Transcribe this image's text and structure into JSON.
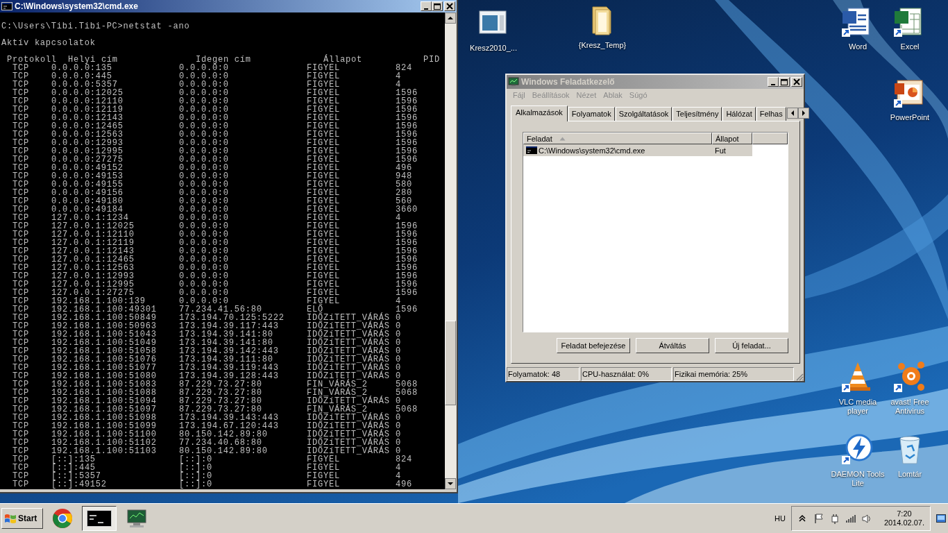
{
  "desktop_icons": [
    {
      "label": "Kresz2010_...",
      "kind": "window-file"
    },
    {
      "label": "{Kresz_Temp}",
      "kind": "folder"
    },
    {
      "label": "Word",
      "kind": "word"
    },
    {
      "label": "Excel",
      "kind": "excel"
    },
    {
      "label": "PowerPoint",
      "kind": "powerpoint"
    },
    {
      "label": "VLC media player",
      "kind": "vlc"
    },
    {
      "label": "avast! Free Antivirus",
      "kind": "avast"
    },
    {
      "label": "DAEMON Tools Lite",
      "kind": "daemon"
    },
    {
      "label": "Lomtár",
      "kind": "recycle-bin"
    }
  ],
  "cmd_window": {
    "title": "C:\\Windows\\system32\\cmd.exe",
    "prompt": "C:\\Users\\Tibi.Tibi-PC>netstat -ano",
    "heading": "Aktív kapcsolatok",
    "columns": [
      "Protokoll",
      "Helyi cím",
      "Idegen cím",
      "Állapot",
      "PID"
    ],
    "rows": [
      [
        "TCP",
        "0.0.0.0:135",
        "0.0.0.0:0",
        "FIGYEL",
        "824"
      ],
      [
        "TCP",
        "0.0.0.0:445",
        "0.0.0.0:0",
        "FIGYEL",
        "4"
      ],
      [
        "TCP",
        "0.0.0.0:5357",
        "0.0.0.0:0",
        "FIGYEL",
        "4"
      ],
      [
        "TCP",
        "0.0.0.0:12025",
        "0.0.0.0:0",
        "FIGYEL",
        "1596"
      ],
      [
        "TCP",
        "0.0.0.0:12110",
        "0.0.0.0:0",
        "FIGYEL",
        "1596"
      ],
      [
        "TCP",
        "0.0.0.0:12119",
        "0.0.0.0:0",
        "FIGYEL",
        "1596"
      ],
      [
        "TCP",
        "0.0.0.0:12143",
        "0.0.0.0:0",
        "FIGYEL",
        "1596"
      ],
      [
        "TCP",
        "0.0.0.0:12465",
        "0.0.0.0:0",
        "FIGYEL",
        "1596"
      ],
      [
        "TCP",
        "0.0.0.0:12563",
        "0.0.0.0:0",
        "FIGYEL",
        "1596"
      ],
      [
        "TCP",
        "0.0.0.0:12993",
        "0.0.0.0:0",
        "FIGYEL",
        "1596"
      ],
      [
        "TCP",
        "0.0.0.0:12995",
        "0.0.0.0:0",
        "FIGYEL",
        "1596"
      ],
      [
        "TCP",
        "0.0.0.0:27275",
        "0.0.0.0:0",
        "FIGYEL",
        "1596"
      ],
      [
        "TCP",
        "0.0.0.0:49152",
        "0.0.0.0:0",
        "FIGYEL",
        "496"
      ],
      [
        "TCP",
        "0.0.0.0:49153",
        "0.0.0.0:0",
        "FIGYEL",
        "948"
      ],
      [
        "TCP",
        "0.0.0.0:49155",
        "0.0.0.0:0",
        "FIGYEL",
        "580"
      ],
      [
        "TCP",
        "0.0.0.0:49156",
        "0.0.0.0:0",
        "FIGYEL",
        "280"
      ],
      [
        "TCP",
        "0.0.0.0:49180",
        "0.0.0.0:0",
        "FIGYEL",
        "560"
      ],
      [
        "TCP",
        "0.0.0.0:49184",
        "0.0.0.0:0",
        "FIGYEL",
        "3660"
      ],
      [
        "TCP",
        "127.0.0.1:1234",
        "0.0.0.0:0",
        "FIGYEL",
        "4"
      ],
      [
        "TCP",
        "127.0.0.1:12025",
        "0.0.0.0:0",
        "FIGYEL",
        "1596"
      ],
      [
        "TCP",
        "127.0.0.1:12110",
        "0.0.0.0:0",
        "FIGYEL",
        "1596"
      ],
      [
        "TCP",
        "127.0.0.1:12119",
        "0.0.0.0:0",
        "FIGYEL",
        "1596"
      ],
      [
        "TCP",
        "127.0.0.1:12143",
        "0.0.0.0:0",
        "FIGYEL",
        "1596"
      ],
      [
        "TCP",
        "127.0.0.1:12465",
        "0.0.0.0:0",
        "FIGYEL",
        "1596"
      ],
      [
        "TCP",
        "127.0.0.1:12563",
        "0.0.0.0:0",
        "FIGYEL",
        "1596"
      ],
      [
        "TCP",
        "127.0.0.1:12993",
        "0.0.0.0:0",
        "FIGYEL",
        "1596"
      ],
      [
        "TCP",
        "127.0.0.1:12995",
        "0.0.0.0:0",
        "FIGYEL",
        "1596"
      ],
      [
        "TCP",
        "127.0.0.1:27275",
        "0.0.0.0:0",
        "FIGYEL",
        "1596"
      ],
      [
        "TCP",
        "192.168.1.100:139",
        "0.0.0.0:0",
        "FIGYEL",
        "4"
      ],
      [
        "TCP",
        "192.168.1.100:49301",
        "77.234.41.56:80",
        "ELŐ",
        "1596"
      ],
      [
        "TCP",
        "192.168.1.100:50849",
        "173.194.70.125:5222",
        "IDŐZíTETT_VÁRÁS",
        "0"
      ],
      [
        "TCP",
        "192.168.1.100:50963",
        "173.194.39.117:443",
        "IDŐZíTETT_VÁRÁS",
        "0"
      ],
      [
        "TCP",
        "192.168.1.100:51043",
        "173.194.39.141:80",
        "IDŐZíTETT_VÁRÁS",
        "0"
      ],
      [
        "TCP",
        "192.168.1.100:51049",
        "173.194.39.141:80",
        "IDŐZíTETT_VÁRÁS",
        "0"
      ],
      [
        "TCP",
        "192.168.1.100:51058",
        "173.194.39.142:443",
        "IDŐZíTETT_VÁRÁS",
        "0"
      ],
      [
        "TCP",
        "192.168.1.100:51076",
        "173.194.39.111:80",
        "IDŐZíTETT_VÁRÁS",
        "0"
      ],
      [
        "TCP",
        "192.168.1.100:51077",
        "173.194.39.119:443",
        "IDŐZíTETT_VÁRÁS",
        "0"
      ],
      [
        "TCP",
        "192.168.1.100:51080",
        "173.194.39.128:443",
        "IDŐZíTETT_VÁRÁS",
        "0"
      ],
      [
        "TCP",
        "192.168.1.100:51083",
        "87.229.73.27:80",
        "FIN_VÁRÁS_2",
        "5068"
      ],
      [
        "TCP",
        "192.168.1.100:51088",
        "87.229.73.27:80",
        "FIN_VÁRÁS_2",
        "5068"
      ],
      [
        "TCP",
        "192.168.1.100:51094",
        "87.229.73.27:80",
        "IDŐZíTETT_VÁRÁS",
        "0"
      ],
      [
        "TCP",
        "192.168.1.100:51097",
        "87.229.73.27:80",
        "FIN_VÁRÁS_2",
        "5068"
      ],
      [
        "TCP",
        "192.168.1.100:51098",
        "173.194.39.143:443",
        "IDŐZíTETT_VÁRÁS",
        "0"
      ],
      [
        "TCP",
        "192.168.1.100:51099",
        "173.194.67.120:443",
        "IDŐZíTETT_VÁRÁS",
        "0"
      ],
      [
        "TCP",
        "192.168.1.100:51100",
        "80.150.142.89:80",
        "IDŐZíTETT_VÁRÁS",
        "0"
      ],
      [
        "TCP",
        "192.168.1.100:51102",
        "77.234.40.68:80",
        "IDŐZíTETT_VÁRÁS",
        "0"
      ],
      [
        "TCP",
        "192.168.1.100:51103",
        "80.150.142.89:80",
        "IDŐZíTETT_VÁRÁS",
        "0"
      ],
      [
        "TCP",
        "[::]:135",
        "[::]:0",
        "FIGYEL",
        "824"
      ],
      [
        "TCP",
        "[::]:445",
        "[::]:0",
        "FIGYEL",
        "4"
      ],
      [
        "TCP",
        "[::]:5357",
        "[::]:0",
        "FIGYEL",
        "4"
      ],
      [
        "TCP",
        "[::]:49152",
        "[::]:0",
        "FIGYEL",
        "496"
      ]
    ]
  },
  "task_manager": {
    "title": "Windows Feladatkezelő",
    "menu": [
      "Fájl",
      "Beállítások",
      "Nézet",
      "Ablak",
      "Súgó"
    ],
    "tabs": [
      {
        "label": "Alkalmazások",
        "selected": true
      },
      {
        "label": "Folyamatok",
        "selected": false
      },
      {
        "label": "Szolgáltatások",
        "selected": false
      },
      {
        "label": "Teljesítmény",
        "selected": false
      },
      {
        "label": "Hálózat",
        "selected": false
      },
      {
        "label": "Felhas",
        "selected": false
      }
    ],
    "columns": [
      {
        "label": "Feladat",
        "sorted": true
      },
      {
        "label": "Állapot",
        "sorted": false
      }
    ],
    "rows": [
      {
        "task": "C:\\Windows\\system32\\cmd.exe",
        "status": "Fut",
        "selected": true
      }
    ],
    "buttons": [
      "Feladat befejezése",
      "Átváltás",
      "Új feladat..."
    ],
    "status_bar": [
      "Folyamatok: 48",
      "CPU-használat: 0%",
      "Fizikai memória: 25%"
    ]
  },
  "taskbar": {
    "start": "Start",
    "apps": [
      {
        "kind": "browser",
        "selected": false
      },
      {
        "kind": "terminal",
        "selected": true
      },
      {
        "kind": "task-manager",
        "selected": false
      }
    ],
    "language": "HU",
    "time": "7:20",
    "date": "2014.02.07."
  }
}
